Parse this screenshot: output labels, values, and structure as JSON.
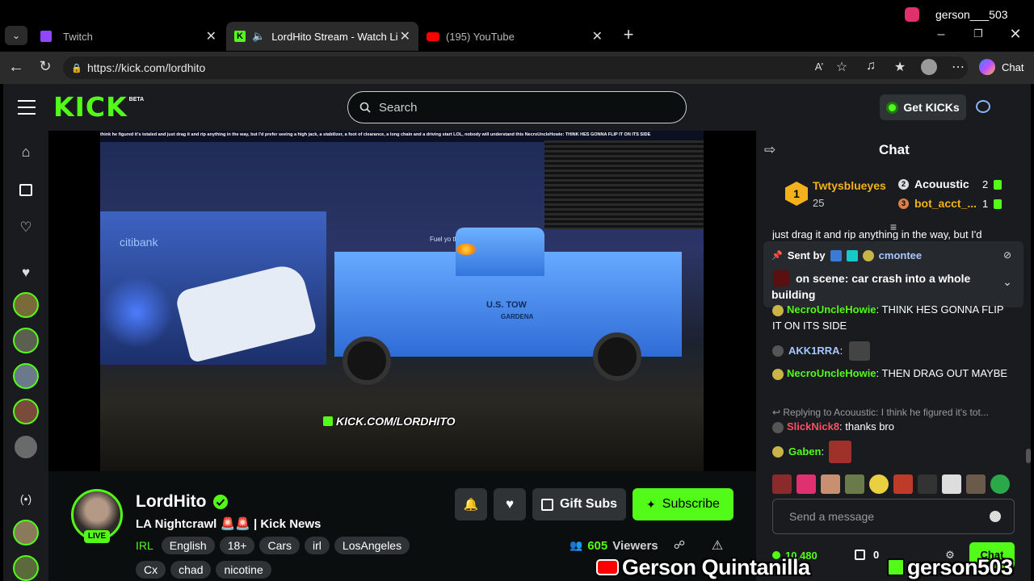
{
  "browser": {
    "tabs": [
      {
        "label": "Twitch"
      },
      {
        "label": "LordHito Stream - Watch Live"
      },
      {
        "label": "(195) YouTube"
      }
    ],
    "url": "https://kick.com/lordhito",
    "profile_name": "gerson___503",
    "chat_label": "Chat"
  },
  "kick": {
    "logo": "KICK",
    "logo_beta": "BETA",
    "search_placeholder": "Search",
    "get_kicks_label": "Get KICKs",
    "video": {
      "ticker": "think he figured it's totaled and just drag it and rip anything in the way, but I'd prefer seeing a high jack, a stabilizer, a foot of clearance, a long chain and a driving start LOL, nobody will understand this  NecroUncleHowie: THINK HES GONNA FLIP IT ON ITS SIDE",
      "watermark": "KICK.COM/LORDHITO",
      "sign_text": "Fuel yo      th with a check",
      "bank_text": "citibank",
      "truck_text": "U.S. TOW",
      "truck_city": "GARDENA"
    },
    "streamer": {
      "name": "LordHito",
      "live_badge": "LIVE",
      "title": "LA Nightcrawl 🚨🚨 | Kick News",
      "category": "IRL",
      "tags": [
        "English",
        "18+",
        "Cars",
        "irl",
        "LosAngeles",
        "Cx",
        "chad",
        "nicotine"
      ],
      "viewers_count": "605",
      "viewers_label": "Viewers",
      "followers_partial": "10,480",
      "gifts_count": "0"
    },
    "buttons": {
      "gift_subs": "Gift Subs",
      "subscribe": "Subscribe"
    },
    "chat": {
      "title": "Chat",
      "leaderboard": [
        {
          "rank": "1",
          "name": "Twtysblueyes",
          "count": "25"
        },
        {
          "rank": "2",
          "name": "Acouustic",
          "count": "2"
        },
        {
          "rank": "3",
          "name": "bot_acct_...",
          "count": "1"
        }
      ],
      "clipped_line": "just drag it and rip anything in the way, but I'd",
      "pinned": {
        "sent_by_label": "Sent by",
        "sender": "cmontee",
        "text": "on scene: car crash into a whole building"
      },
      "messages": [
        {
          "user": "NecroUncleHowie",
          "text": "THINK HES GONNA FLIP IT ON ITS SIDE"
        },
        {
          "user": "AKK1RRA",
          "text": ""
        },
        {
          "user": "NecroUncleHowie",
          "text": "THEN DRAG OUT MAYBE"
        },
        {
          "reply": "Replying to Acouustic: I think he figured it's tot...",
          "user": "SlickNick8",
          "text": "thanks bro"
        },
        {
          "user": "Gaben",
          "text": ""
        }
      ],
      "input_placeholder": "Send a message",
      "send_label": "Chat"
    }
  },
  "overlay": {
    "youtube_name": "Gerson Quintanilla",
    "kick_name": "gerson503"
  },
  "colors": {
    "kick_green": "#53fc18",
    "panel": "#191b1f",
    "background": "#0b0e0f"
  }
}
